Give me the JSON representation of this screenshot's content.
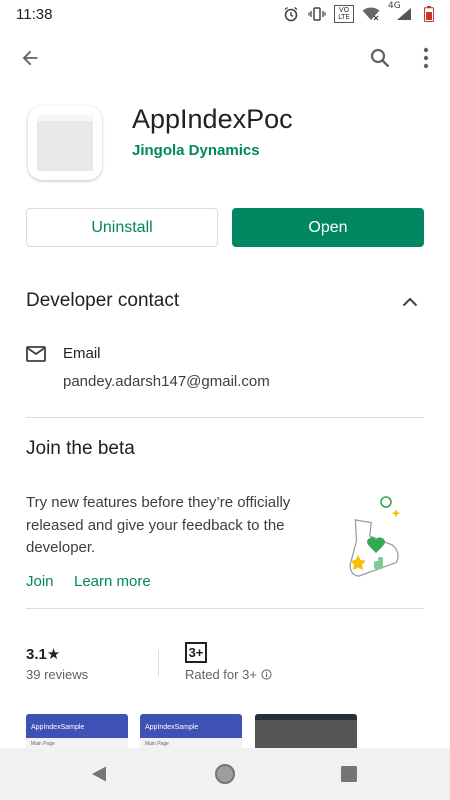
{
  "status_bar": {
    "time": "11:38",
    "lte_label": "VO LTE",
    "network_label": "4G",
    "icons": [
      "alarm-icon",
      "vibrate-icon",
      "lte-icon",
      "wifi-icon",
      "signal-icon",
      "battery-icon"
    ]
  },
  "toolbar": {
    "icons": [
      "back-arrow-icon",
      "search-icon",
      "more-vert-icon"
    ]
  },
  "app": {
    "title": "AppIndexPoc",
    "developer": "Jingola Dynamics",
    "uninstall_label": "Uninstall",
    "open_label": "Open"
  },
  "developer_contact": {
    "title": "Developer contact",
    "email_label": "Email",
    "email_value": "pandey.adarsh147@gmail.com"
  },
  "beta": {
    "title": "Join the beta",
    "description": "Try new features before they’re officially released and give your feedback to the developer.",
    "join_label": "Join",
    "learn_more_label": "Learn more"
  },
  "stats": {
    "rating": "3.1★",
    "reviews": "39 reviews",
    "content_rating_badge": "3+",
    "content_rating_label": "Rated for 3+"
  },
  "screenshots": [
    {
      "bar_title": "AppIndexSample",
      "body_text": "Main Page"
    },
    {
      "bar_title": "AppIndexSample",
      "body_text": "Main Page"
    }
  ],
  "colors": {
    "accent": "#01875f",
    "text": "#202124",
    "secondary_text": "#5f6368",
    "divider": "#dadce0"
  }
}
